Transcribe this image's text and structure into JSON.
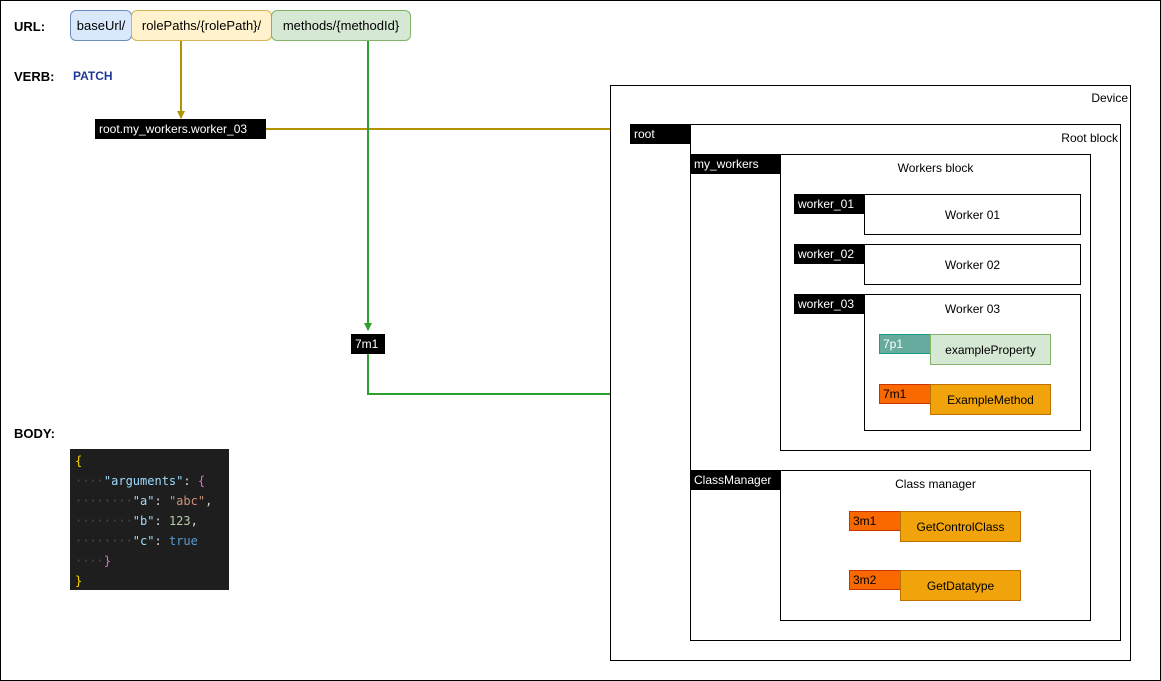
{
  "url": {
    "label": "URL:",
    "segments": [
      "baseUrl/",
      "rolePaths/{rolePath}/",
      "methods/{methodId}"
    ]
  },
  "verb": {
    "label": "VERB:",
    "value": "PATCH"
  },
  "body": {
    "label": "BODY:",
    "code": {
      "open": "{",
      "key_arguments": "\"arguments\"",
      "key_a": "\"a\"",
      "val_a": "\"abc\"",
      "key_b": "\"b\"",
      "val_b": "123",
      "key_c": "\"c\"",
      "val_c": "true",
      "inner_close": "}",
      "close": "}"
    }
  },
  "role_path_tag": "root.my_workers.worker_03",
  "method_tag": "7m1",
  "device": {
    "title": "Device",
    "root_tag": "root",
    "root_block": {
      "title": "Root block",
      "my_workers_tag": "my_workers",
      "workers_block": {
        "title": "Workers block",
        "workers": [
          {
            "tag": "worker_01",
            "title": "Worker 01"
          },
          {
            "tag": "worker_02",
            "title": "Worker 02"
          },
          {
            "tag": "worker_03",
            "title": "Worker 03"
          }
        ],
        "property": {
          "id": "7p1",
          "name": "exampleProperty"
        },
        "method": {
          "id": "7m1",
          "name": "ExampleMethod"
        }
      },
      "class_manager_tag": "ClassManager",
      "class_manager": {
        "title": "Class manager",
        "methods": [
          {
            "id": "3m1",
            "name": "GetControlClass"
          },
          {
            "id": "3m2",
            "name": "GetDatatype"
          }
        ]
      }
    }
  },
  "colors": {
    "base_url_fill": "#dae8fc",
    "base_url_border": "#6c8ebf",
    "role_fill": "#fff2cc",
    "role_border": "#d6b656",
    "method_fill": "#d5e8d4",
    "method_border": "#82b366",
    "olive_arrow": "#b09500",
    "green_arrow": "#2ca02c",
    "verb_text": "#1f3a93",
    "prop_id_fill": "#67ab9f",
    "prop_name_fill": "#d5e8d4",
    "method_id_fill": "#fa6800",
    "method_name_fill": "#f0a30a"
  }
}
